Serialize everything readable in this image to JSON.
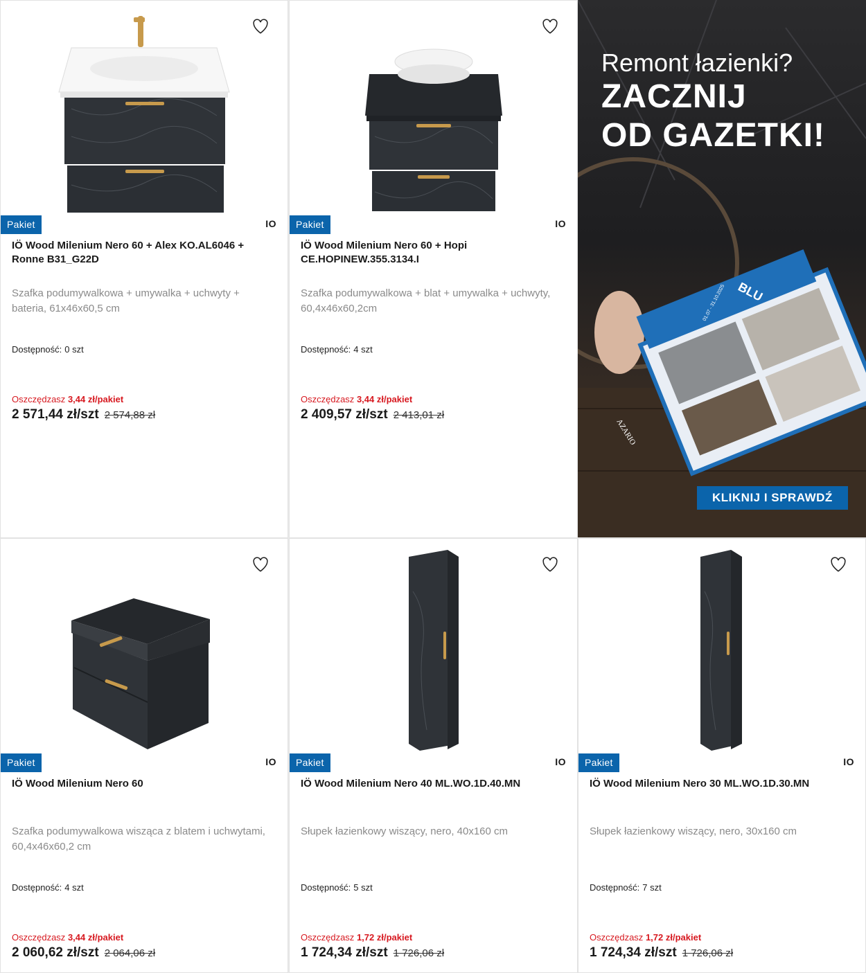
{
  "products": [
    {
      "badge": "Pakiet",
      "brand": "IO",
      "title": "IÖ Wood Milenium Nero 60 + Alex KO.AL6046 + Ronne B31_G22D",
      "desc": "Szafka podumywalkowa + umywalka + uchwyty + bateria, 61x46x60,5 cm",
      "stock_label": "Dostępność:",
      "stock_value": "0 szt",
      "save_label": "Oszczędzasz",
      "save_value": "3,44 zł/pakiet",
      "price": "2 571,44 zł/szt",
      "old_price": "2 574,88 zł"
    },
    {
      "badge": "Pakiet",
      "brand": "IO",
      "title": "IÖ Wood Milenium Nero 60 + Hopi CE.HOPINEW.355.3134.I",
      "desc": "Szafka podumywalkowa + blat + umywalka + uchwyty, 60,4x46x60,2cm",
      "stock_label": "Dostępność:",
      "stock_value": "4 szt",
      "save_label": "Oszczędzasz",
      "save_value": "3,44 zł/pakiet",
      "price": "2 409,57 zł/szt",
      "old_price": "2 413,01 zł"
    },
    {
      "badge": "Pakiet",
      "brand": "IO",
      "title": "IÖ Wood Milenium Nero 60",
      "desc": "Szafka podumywalkowa wisząca z blatem i uchwytami, 60,4x46x60,2 cm",
      "stock_label": "Dostępność:",
      "stock_value": "4 szt",
      "save_label": "Oszczędzasz",
      "save_value": "3,44 zł/pakiet",
      "price": "2 060,62 zł/szt",
      "old_price": "2 064,06 zł"
    },
    {
      "badge": "Pakiet",
      "brand": "IO",
      "title": "IÖ Wood Milenium Nero 40 ML.WO.1D.40.MN",
      "desc": "Słupek łazienkowy wiszący, nero, 40x160 cm",
      "stock_label": "Dostępność:",
      "stock_value": "5 szt",
      "save_label": "Oszczędzasz",
      "save_value": "1,72 zł/pakiet",
      "price": "1 724,34 zł/szt",
      "old_price": "1 726,06 zł"
    },
    {
      "badge": "Pakiet",
      "brand": "IO",
      "title": "IÖ Wood Milenium Nero 30 ML.WO.1D.30.MN",
      "desc": "Słupek łazienkowy wiszący, nero, 30x160 cm",
      "stock_label": "Dostępność:",
      "stock_value": "7 szt",
      "save_label": "Oszczędzasz",
      "save_value": "1,72 zł/pakiet",
      "price": "1 724,34 zł/szt",
      "old_price": "1 726,06 zł"
    }
  ],
  "promo": {
    "line1": "Remont łazienki?",
    "line2": "ZACZNIJ",
    "line3": "OD GAZETKI!",
    "cta": "KLIKNIJ I SPRAWDŹ",
    "brochure_brand": "BLU",
    "brochure_dates": "01.07 - 31.10.2025",
    "brochure_word": "AZARIO"
  },
  "colors": {
    "accent": "#0b64ab",
    "sale": "#d71920",
    "cabinet": "#2f3338"
  }
}
